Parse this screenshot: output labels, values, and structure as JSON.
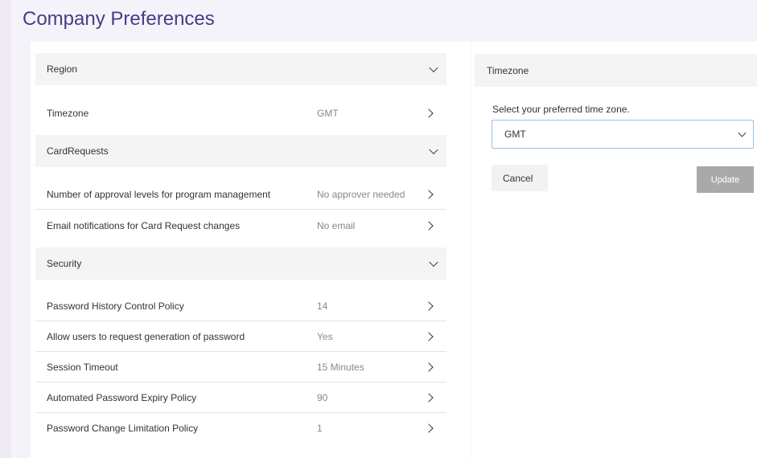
{
  "page": {
    "title": "Company Preferences"
  },
  "left": {
    "region": {
      "header": "Region",
      "rows": [
        {
          "label": "Timezone",
          "value": "GMT"
        }
      ]
    },
    "card_requests": {
      "header": "CardRequests",
      "rows": [
        {
          "label": "Number of approval levels for program management",
          "value": "No approver needed"
        },
        {
          "label": "Email notifications for Card Request changes",
          "value": "No email"
        }
      ]
    },
    "security": {
      "header": "Security",
      "rows": [
        {
          "label": "Password History Control Policy",
          "value": "14"
        },
        {
          "label": "Allow users to request generation of password",
          "value": "Yes"
        },
        {
          "label": "Session Timeout",
          "value": "15 Minutes"
        },
        {
          "label": "Automated Password Expiry Policy",
          "value": "90"
        },
        {
          "label": "Password Change Limitation Policy",
          "value": "1"
        }
      ]
    }
  },
  "right": {
    "header": "Timezone",
    "prompt": "Select your preferred time zone.",
    "select_value": "GMT",
    "cancel_label": "Cancel",
    "update_label": "Update"
  },
  "colors": {
    "title": "#4d3a86",
    "update_button_disabled": "#a9a9a9",
    "select_border": "#9dc0e4"
  },
  "icons": {
    "section_toggle": "chevron-down-icon",
    "row_nav": "chevron-right-icon"
  }
}
